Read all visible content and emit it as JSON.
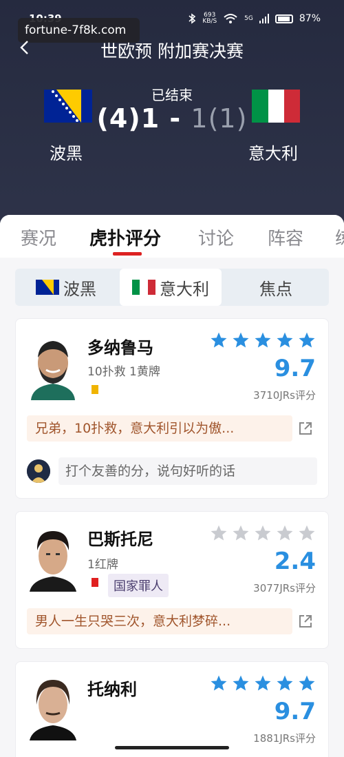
{
  "status_bar": {
    "time": "10:39",
    "network_speed_top": "693",
    "network_speed_bottom": "KB/S",
    "signal_label": "5G",
    "battery": "87%"
  },
  "watermark": "fortune-7f8k.com",
  "header": {
    "title": "世欧预 附加赛决赛",
    "back_icon": "chevron-left-icon"
  },
  "match": {
    "home_team": "波黑",
    "away_team": "意大利",
    "status": "已结束",
    "score_home_pen": "(4)",
    "score_home": "1",
    "score_sep": " - ",
    "score_away": "1",
    "score_away_pen": "(1)"
  },
  "tabs": [
    {
      "label": "赛况",
      "active": false
    },
    {
      "label": "虎扑评分",
      "active": true
    },
    {
      "label": "讨论",
      "active": false
    },
    {
      "label": "阵容",
      "active": false
    },
    {
      "label": "练",
      "active": false
    }
  ],
  "subtabs": [
    {
      "label": "波黑",
      "flag": "bih"
    },
    {
      "label": "意大利",
      "flag": "ita"
    },
    {
      "label": "焦点",
      "flag": ""
    }
  ],
  "colors": {
    "rating_blue": "#2a8fe0",
    "star_blue": "#2a8fe0",
    "star_gray": "#c9cbd0",
    "accent_red": "#dd2222"
  },
  "players": [
    {
      "name": "多纳鲁马",
      "stats": "10扑救 1黄牌",
      "card": "yellow",
      "tag": "",
      "stars_filled": 5,
      "rating": "9.7",
      "rating_count": "3710JRs评分",
      "comment": "兄弟，10扑救，意大利引以为傲...",
      "compose_placeholder": "打个友善的分，说句好听的话"
    },
    {
      "name": "巴斯托尼",
      "stats": "1红牌",
      "card": "red",
      "tag": "国家罪人",
      "stars_filled": 0,
      "rating": "2.4",
      "rating_count": "3077JRs评分",
      "comment": "男人一生只哭三次，意大利梦碎..."
    },
    {
      "name": "托纳利",
      "stars_filled": 5,
      "rating": "9.7",
      "rating_count": "1881JRs评分"
    }
  ]
}
